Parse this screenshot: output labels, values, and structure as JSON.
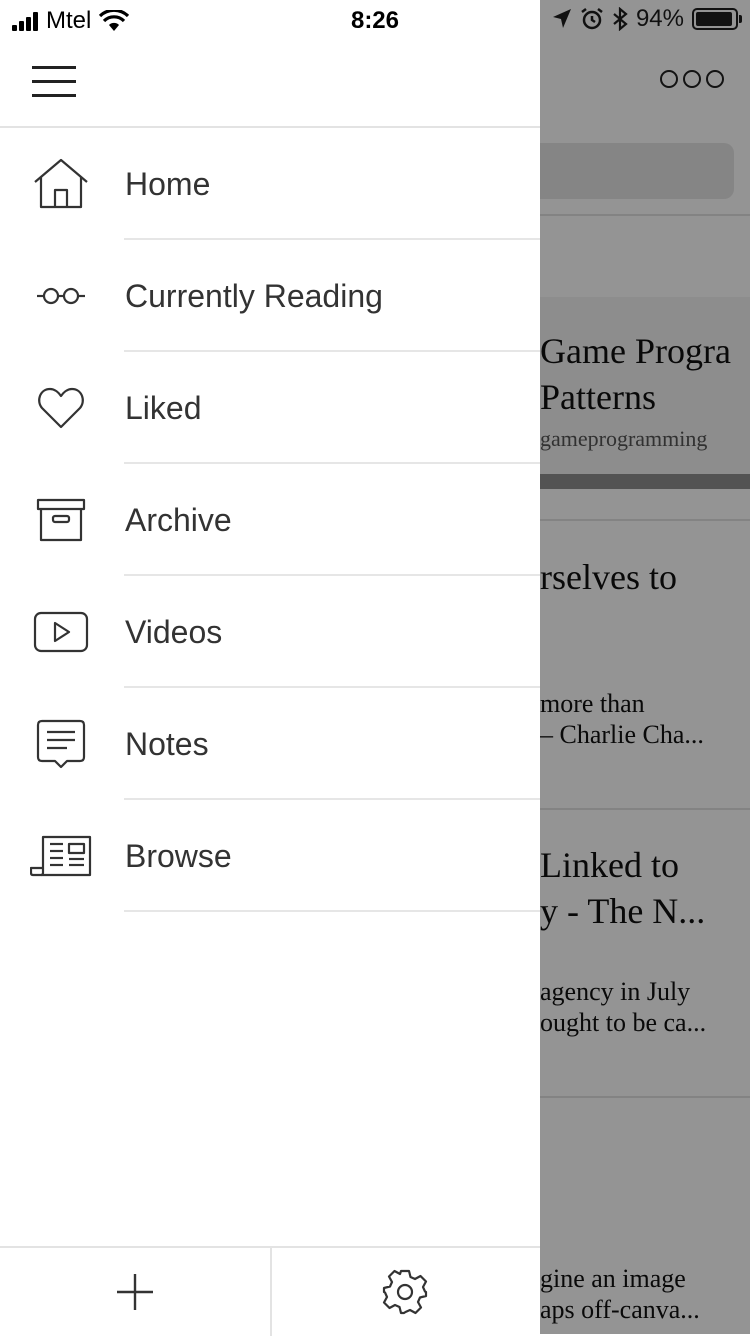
{
  "status_bar": {
    "carrier": "Mtel",
    "time": "8:26",
    "battery_percent": "94%",
    "battery_level": 0.94
  },
  "menu": {
    "items": [
      {
        "label": "Home",
        "icon": "home-icon"
      },
      {
        "label": "Currently Reading",
        "icon": "glasses-icon"
      },
      {
        "label": "Liked",
        "icon": "heart-icon"
      },
      {
        "label": "Archive",
        "icon": "archive-icon"
      },
      {
        "label": "Videos",
        "icon": "video-icon"
      },
      {
        "label": "Notes",
        "icon": "notes-icon"
      },
      {
        "label": "Browse",
        "icon": "newspaper-icon"
      }
    ]
  },
  "bottom_bar": {
    "add_icon": "plus-icon",
    "settings_icon": "gear-icon"
  },
  "background": {
    "featured": {
      "title_line1": "Game Progra",
      "title_line2": "Patterns",
      "source": "gameprogramming"
    },
    "articles": [
      {
        "title_line1": "rselves to",
        "title_line2": "",
        "excerpt_line1": " more than",
        "excerpt_line2": "– Charlie Cha..."
      },
      {
        "title_line1": "Linked to",
        "title_line2": "y - The N...",
        "excerpt_line1": " agency in July",
        "excerpt_line2": "ought to be ca..."
      },
      {
        "excerpt_line1": "gine an image",
        "excerpt_line2": "aps off-canva..."
      }
    ]
  },
  "colors": {
    "overlay": "#6b6b6b",
    "text": "#333333",
    "separator": "#e6e6e6"
  }
}
